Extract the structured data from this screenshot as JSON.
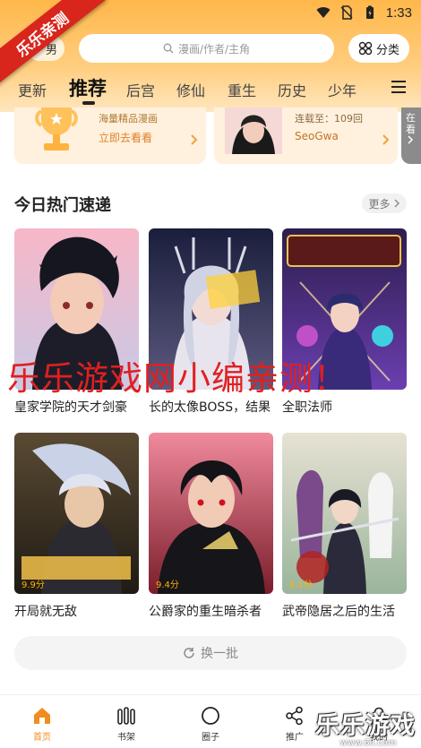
{
  "status": {
    "time": "1:33"
  },
  "corner_ribbon": "乐乐亲测",
  "header": {
    "gender_label": "男",
    "search_placeholder": "漫画/作者/主角",
    "category_label": "分类"
  },
  "tabs": [
    "更新",
    "推荐",
    "后宫",
    "修仙",
    "重生",
    "历史",
    "少年"
  ],
  "banners": [
    {
      "title": "海量精品漫画",
      "subtitle": "立即去看看"
    },
    {
      "title": "连载至：109回",
      "subtitle": "SeoGwa"
    }
  ],
  "side_tab": "在看",
  "section": {
    "title": "今日热门速递",
    "more_label": "更多"
  },
  "comics": [
    {
      "title": "皇家学院的天才剑豪",
      "score": ""
    },
    {
      "title": "长的太像BOSS，结果",
      "score": ""
    },
    {
      "title": "全职法师",
      "score": ""
    },
    {
      "title": "开局就无敌",
      "score": "9.9分"
    },
    {
      "title": "公爵家的重生暗杀者",
      "score": "9.4分"
    },
    {
      "title": "武帝隐居之后的生活",
      "score": "9.1分"
    }
  ],
  "watermark": "乐乐游戏网小编亲测！",
  "refresh_label": "换一批",
  "bottom_nav": [
    "首页",
    "书架",
    "圈子",
    "推广",
    "我的"
  ],
  "logo": {
    "text": "乐乐游戏",
    "url": "www.6ll.com"
  },
  "colors": {
    "accent": "#f28c1e",
    "header": "#ffb74a",
    "watermark": "#e02020"
  }
}
